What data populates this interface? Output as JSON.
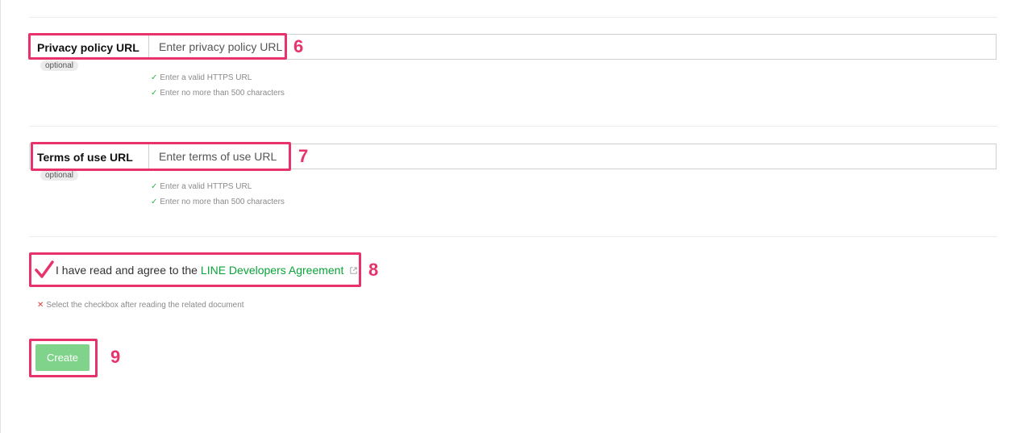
{
  "privacy_field": {
    "label": "Privacy policy URL",
    "optional": "optional",
    "placeholder": "Enter privacy policy URL",
    "value": "",
    "hints": [
      "Enter a valid HTTPS URL",
      "Enter no more than 500 characters"
    ],
    "step_badge": "6"
  },
  "terms_field": {
    "label": "Terms of use URL",
    "optional": "optional",
    "placeholder": "Enter terms of use URL",
    "value": "",
    "hints": [
      "Enter a valid HTTPS URL",
      "Enter no more than 500 characters"
    ],
    "step_badge": "7"
  },
  "agreement": {
    "text": "I have read and agree to the",
    "link_text": "LINE Developers Agreement",
    "checked": true,
    "error": "Select the checkbox after reading the related document",
    "step_badge": "8"
  },
  "create": {
    "label": "Create",
    "step_badge": "9"
  },
  "colors": {
    "accent_highlight": "#e8326b",
    "link_green": "#0aa33a",
    "button_green": "#7fd38b",
    "check_ok": "#2fb44a",
    "error_red": "#e03a3a"
  }
}
